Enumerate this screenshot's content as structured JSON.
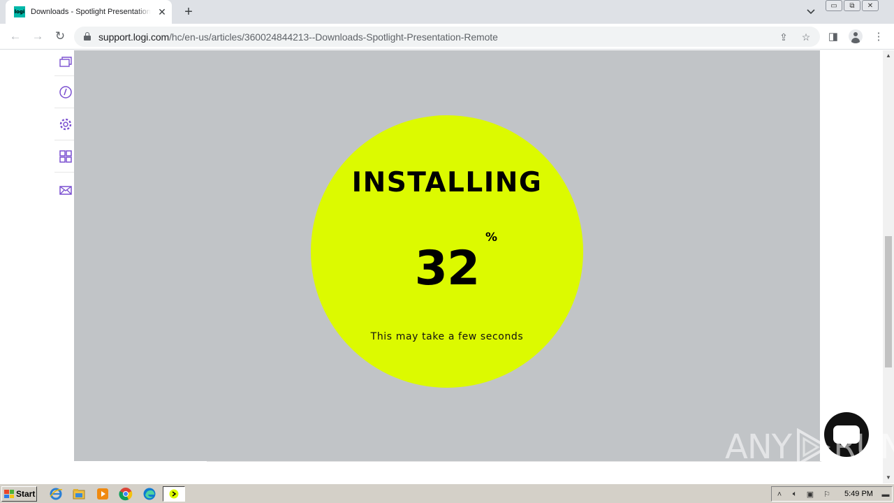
{
  "browser": {
    "tab": {
      "favicon_text": "logi",
      "title": "Downloads - Spotlight Presentation Remote",
      "close_glyph": "✕"
    },
    "new_tab_glyph": "+",
    "tab_search_glyph": "⌄",
    "window_controls": [
      "▭",
      "⧉",
      "✕"
    ],
    "toolbar": {
      "back_glyph": "←",
      "forward_glyph": "→",
      "reload_glyph": "↻",
      "url_host": "support.logi.com",
      "url_path": "/hc/en-us/articles/360024844213--Downloads-Spotlight-Presentation-Remote",
      "share_glyph": "⇪",
      "bookmark_glyph": "☆",
      "sidepanel_glyph": "◨",
      "menu_glyph": "⋮"
    }
  },
  "sidebar": {
    "icons": [
      "layers-icon",
      "support-icon",
      "settings-icon",
      "apps-icon",
      "mail-icon"
    ],
    "accent_color": "#7a4fd0"
  },
  "installer": {
    "heading": "INSTALLING",
    "progress_value": "32",
    "progress_unit": "%",
    "subtext": "This may take a few seconds",
    "circle_color": "#dcfa00",
    "overlay_color": "#c1c4c7"
  },
  "watermark": {
    "left": "ANY",
    "right": "RUN"
  },
  "taskbar": {
    "start_label": "Start",
    "apps": [
      "internet-explorer-icon",
      "file-explorer-icon",
      "media-player-icon",
      "chrome-icon",
      "edge-icon",
      "installer-app-icon"
    ],
    "clock": "5:49 PM"
  }
}
